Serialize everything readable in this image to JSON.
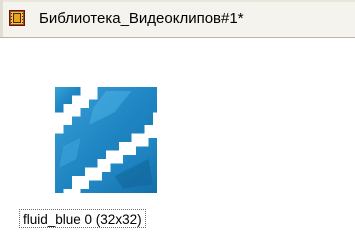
{
  "window": {
    "title": "Библиотека_Видеоклипов#1*",
    "icon": "video-library-icon"
  },
  "library": {
    "items": [
      {
        "label": "fluid_blue 0 (32x32)",
        "thumbnail_icon": "fluid-blue-texture-thumbnail",
        "thumbnail_color": "#1f86c3"
      }
    ]
  },
  "colors": {
    "titlebar_bg": "#f4f3ee",
    "content_bg": "#ffffff",
    "texture_main": "#1f86c3",
    "texture_dark": "#136fa8",
    "texture_light": "#3aa0d6"
  }
}
